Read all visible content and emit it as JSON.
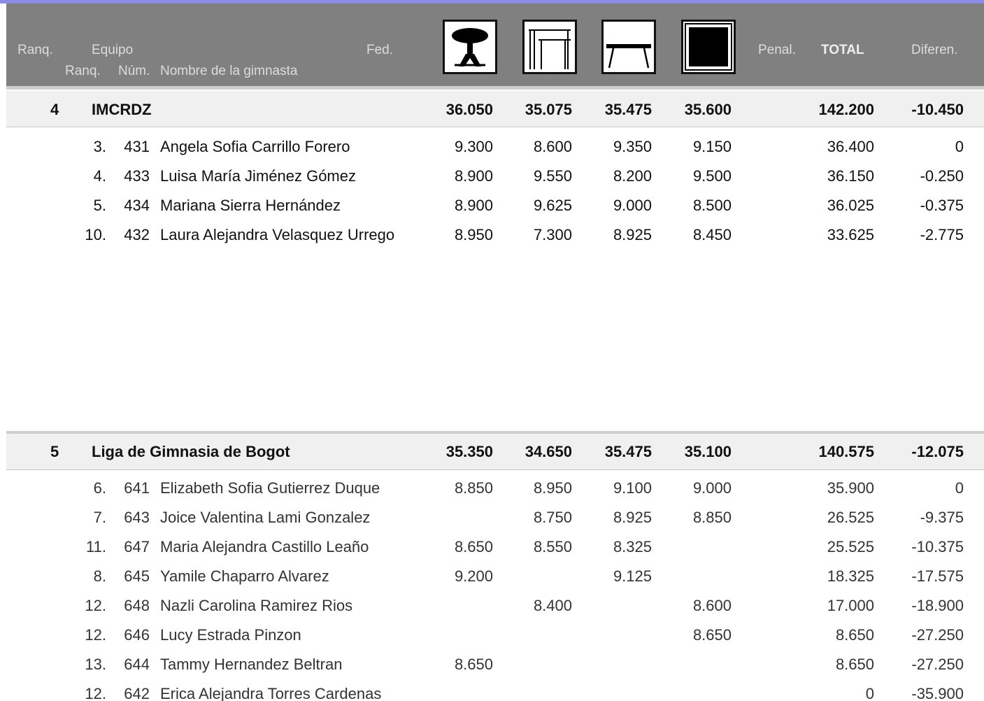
{
  "header": {
    "rank_label": "Ranq.",
    "team_label": "Equipo",
    "fed_label": "Fed.",
    "sub_rank_label": "Ranq.",
    "number_label": "Núm.",
    "name_label": "Nombre de la gimnasta",
    "penalty_label": "Penal.",
    "total_label": "TOTAL",
    "diff_label": "Diferen.",
    "apparatus_icons": [
      "vault-icon",
      "uneven-bars-icon",
      "balance-beam-icon",
      "floor-exercise-icon"
    ]
  },
  "teams": [
    {
      "rank": "4",
      "name": "IMCRDZ",
      "scores": [
        "36.050",
        "35.075",
        "35.475",
        "35.600"
      ],
      "total": "142.200",
      "diff": "-10.450",
      "gymnasts": [
        {
          "rank": "3.",
          "num": "431",
          "name": "Angela Sofia Carrillo Forero",
          "scores": [
            "9.300",
            "8.600",
            "9.350",
            "9.150"
          ],
          "total": "36.400",
          "diff": "0"
        },
        {
          "rank": "4.",
          "num": "433",
          "name": "Luisa María Jiménez Gómez",
          "scores": [
            "8.900",
            "9.550",
            "8.200",
            "9.500"
          ],
          "total": "36.150",
          "diff": "-0.250"
        },
        {
          "rank": "5.",
          "num": "434",
          "name": "Mariana Sierra Hernández",
          "scores": [
            "8.900",
            "9.625",
            "9.000",
            "8.500"
          ],
          "total": "36.025",
          "diff": "-0.375"
        },
        {
          "rank": "10.",
          "num": "432",
          "name": "Laura Alejandra Velasquez  Urrego",
          "scores": [
            "8.950",
            "7.300",
            "8.925",
            "8.450"
          ],
          "total": "33.625",
          "diff": "-2.775"
        }
      ]
    },
    {
      "rank": "5",
      "name": "Liga de Gimnasia de Bogot",
      "scores": [
        "35.350",
        "34.650",
        "35.475",
        "35.100"
      ],
      "total": "140.575",
      "diff": "-12.075",
      "gymnasts": [
        {
          "rank": "6.",
          "num": "641",
          "name": "Elizabeth Sofia Gutierrez Duque",
          "scores": [
            "8.850",
            "8.950",
            "9.100",
            "9.000"
          ],
          "total": "35.900",
          "diff": "0"
        },
        {
          "rank": "7.",
          "num": "643",
          "name": "Joice Valentina Lami Gonzalez",
          "scores": [
            "",
            "8.750",
            "8.925",
            "8.850"
          ],
          "total": "26.525",
          "diff": "-9.375"
        },
        {
          "rank": "11.",
          "num": "647",
          "name": "Maria Alejandra Castillo Leaño",
          "scores": [
            "8.650",
            "8.550",
            "8.325",
            ""
          ],
          "total": "25.525",
          "diff": "-10.375"
        },
        {
          "rank": "8.",
          "num": "645",
          "name": "Yamile  Chaparro Alvarez",
          "scores": [
            "9.200",
            "",
            "9.125",
            ""
          ],
          "total": "18.325",
          "diff": "-17.575"
        },
        {
          "rank": "12.",
          "num": "648",
          "name": "Nazli Carolina Ramirez Rios",
          "scores": [
            "",
            "8.400",
            "",
            "8.600"
          ],
          "total": "17.000",
          "diff": "-18.900"
        },
        {
          "rank": "12.",
          "num": "646",
          "name": "Lucy Estrada Pinzon",
          "scores": [
            "",
            "",
            "",
            "8.650"
          ],
          "total": "8.650",
          "diff": "-27.250"
        },
        {
          "rank": "13.",
          "num": "644",
          "name": "Tammy Hernandez Beltran",
          "scores": [
            "8.650",
            "",
            "",
            ""
          ],
          "total": "8.650",
          "diff": "-27.250"
        },
        {
          "rank": "12.",
          "num": "642",
          "name": "Erica Alejandra Torres Cardenas",
          "scores": [
            "",
            "",
            "",
            ""
          ],
          "total": "0",
          "diff": "-35.900"
        }
      ]
    }
  ]
}
